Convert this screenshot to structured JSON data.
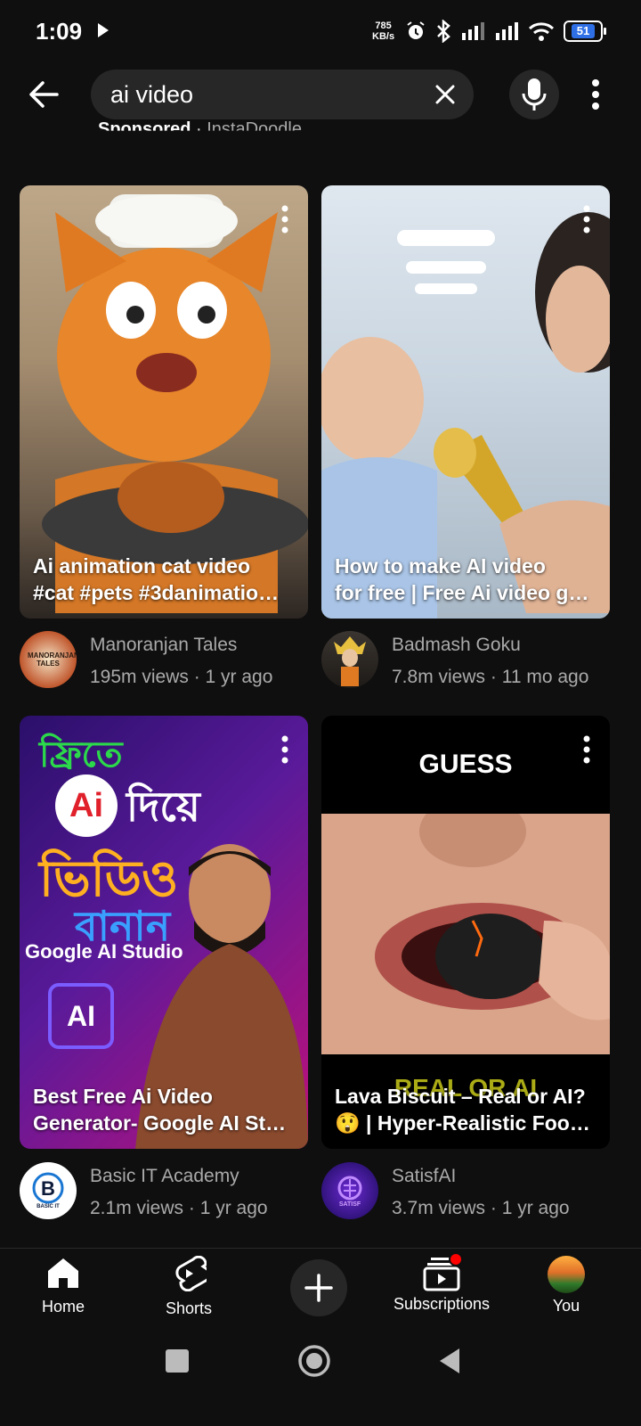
{
  "status_bar": {
    "time": "1:09",
    "net_speed_value": "785",
    "net_speed_unit": "KB/s",
    "battery": "51"
  },
  "header": {
    "search_query": "ai video"
  },
  "sponsored": {
    "label": "Sponsored",
    "separator": "·",
    "advertiser": "InstaDoodle"
  },
  "videos": [
    {
      "title": "Ai animation cat video\n#cat #pets #3danimatio…",
      "channel": "Manoranjan Tales",
      "meta": "195m views · 1 yr ago",
      "avatar_text": "MANORANJAN TALES"
    },
    {
      "title": "How to make AI video\nfor free | Free Ai video g…",
      "channel": "Badmash Goku",
      "meta": "7.8m views · 11 mo ago"
    },
    {
      "title": "Best Free Ai Video\nGenerator- Google AI St…",
      "channel": "Basic IT Academy",
      "meta": "2.1m views · 1 yr ago",
      "avatar_text": "BASIC IT"
    },
    {
      "title": "Lava Biscuit – Real or AI?\n😲 | Hyper-Realistic Foo…",
      "channel": "SatisfAI",
      "meta": "3.7m views · 1 yr ago",
      "avatar_text": "SATISF"
    }
  ],
  "thumb_text": {
    "bengali_line1": "ফ্রিতে",
    "bengali_ai": "Ai",
    "bengali_line2": "দিয়ে",
    "bengali_line3": "ভিডিও",
    "bengali_line4": "বানান",
    "google_ai_studio": "Google AI Studio",
    "ai_badge": "AI",
    "guess": "GUESS",
    "real_or_ai": "REAL OR AI"
  },
  "nav": {
    "home": "Home",
    "shorts": "Shorts",
    "subscriptions": "Subscriptions",
    "you": "You"
  },
  "colors": {
    "background": "#0f0f0f",
    "surface": "#272727",
    "notification_dot": "#ff0000"
  }
}
